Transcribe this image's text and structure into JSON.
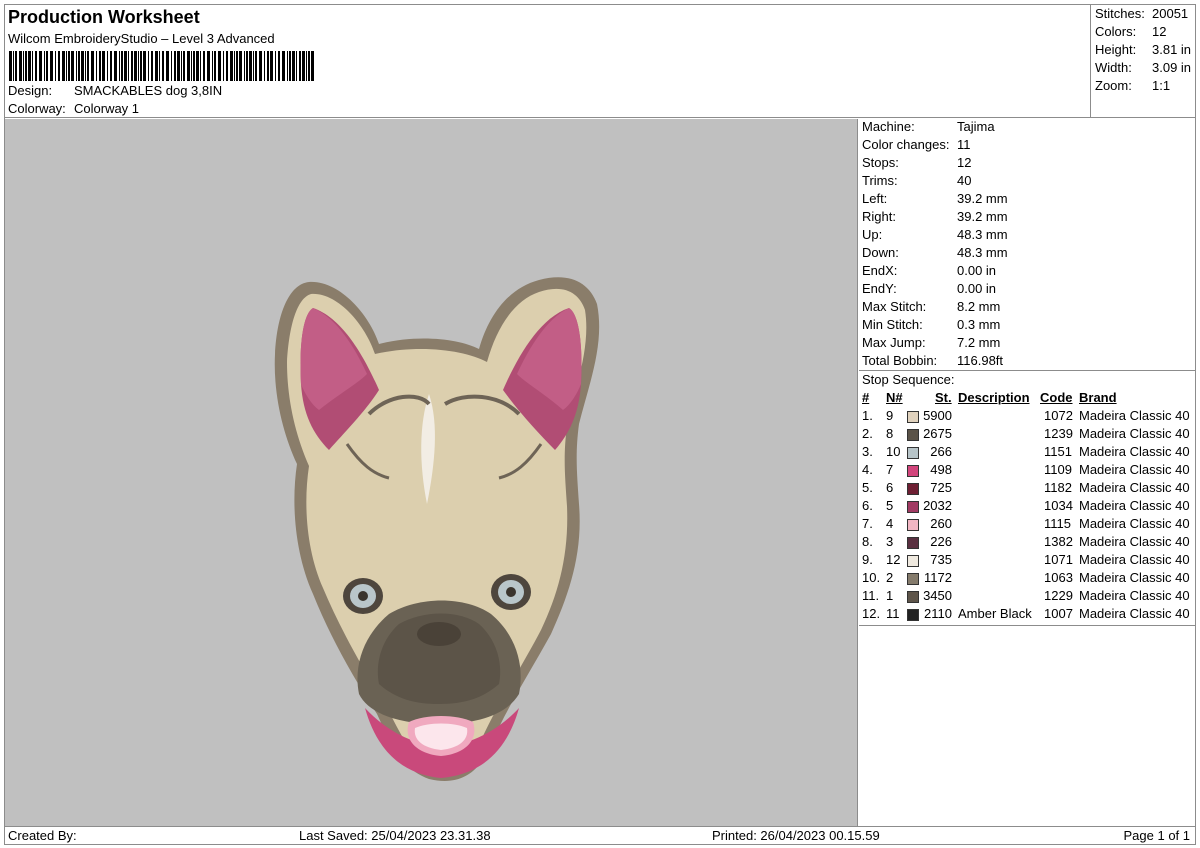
{
  "header": {
    "title": "Production Worksheet",
    "subtitle": "Wilcom EmbroideryStudio – Level 3 Advanced",
    "design_label": "Design:",
    "design_value": "SMACKABLES dog 3,8IN",
    "colorway_label": "Colorway:",
    "colorway_value": "Colorway 1"
  },
  "summary": [
    {
      "label": "Stitches:",
      "value": "20051"
    },
    {
      "label": "Colors:",
      "value": "12"
    },
    {
      "label": "Height:",
      "value": "3.81 in"
    },
    {
      "label": "Width:",
      "value": "3.09 in"
    },
    {
      "label": "Zoom:",
      "value": "1:1"
    }
  ],
  "machine": [
    {
      "label": "Machine:",
      "value": "Tajima"
    },
    {
      "label": "Color changes:",
      "value": "11"
    },
    {
      "label": "Stops:",
      "value": "12"
    },
    {
      "label": "Trims:",
      "value": "40"
    },
    {
      "label": "Left:",
      "value": "39.2 mm"
    },
    {
      "label": "Right:",
      "value": "39.2 mm"
    },
    {
      "label": "Up:",
      "value": "48.3 mm"
    },
    {
      "label": "Down:",
      "value": "48.3 mm"
    },
    {
      "label": "EndX:",
      "value": "0.00 in"
    },
    {
      "label": "EndY:",
      "value": "0.00 in"
    },
    {
      "label": "Max Stitch:",
      "value": "8.2 mm"
    },
    {
      "label": "Min Stitch:",
      "value": "0.3 mm"
    },
    {
      "label": "Max Jump:",
      "value": "7.2 mm"
    },
    {
      "label": "Total Bobbin:",
      "value": "116.98ft"
    }
  ],
  "stop_sequence": {
    "title": "Stop Sequence:",
    "headers": {
      "num": "#",
      "n": "N#",
      "st": "St.",
      "desc": "Description",
      "code": "Code",
      "brand": "Brand"
    },
    "rows": [
      {
        "num": "1.",
        "n": "9",
        "color": "#e0d2bd",
        "st": "5900",
        "desc": "",
        "code": "1072",
        "brand": "Madeira Classic 40"
      },
      {
        "num": "2.",
        "n": "8",
        "color": "#5b5348",
        "st": "2675",
        "desc": "",
        "code": "1239",
        "brand": "Madeira Classic 40"
      },
      {
        "num": "3.",
        "n": "10",
        "color": "#b7c4c8",
        "st": "266",
        "desc": "",
        "code": "1151",
        "brand": "Madeira Classic 40"
      },
      {
        "num": "4.",
        "n": "7",
        "color": "#d2457c",
        "st": "498",
        "desc": "",
        "code": "1109",
        "brand": "Madeira Classic 40"
      },
      {
        "num": "5.",
        "n": "6",
        "color": "#6e1f33",
        "st": "725",
        "desc": "",
        "code": "1182",
        "brand": "Madeira Classic 40"
      },
      {
        "num": "6.",
        "n": "5",
        "color": "#a13a63",
        "st": "2032",
        "desc": "",
        "code": "1034",
        "brand": "Madeira Classic 40"
      },
      {
        "num": "7.",
        "n": "4",
        "color": "#f2b6c3",
        "st": "260",
        "desc": "",
        "code": "1115",
        "brand": "Madeira Classic 40"
      },
      {
        "num": "8.",
        "n": "3",
        "color": "#5a3040",
        "st": "226",
        "desc": "",
        "code": "1382",
        "brand": "Madeira Classic 40"
      },
      {
        "num": "9.",
        "n": "12",
        "color": "#efe9df",
        "st": "735",
        "desc": "",
        "code": "1071",
        "brand": "Madeira Classic 40"
      },
      {
        "num": "10.",
        "n": "2",
        "color": "#857b6c",
        "st": "1172",
        "desc": "",
        "code": "1063",
        "brand": "Madeira Classic 40"
      },
      {
        "num": "11.",
        "n": "1",
        "color": "#5e554a",
        "st": "3450",
        "desc": "",
        "code": "1229",
        "brand": "Madeira Classic 40"
      },
      {
        "num": "12.",
        "n": "11",
        "color": "#222222",
        "st": "2110",
        "desc": "Amber Black",
        "code": "1007",
        "brand": "Madeira Classic 40"
      }
    ]
  },
  "footer": {
    "created_by": "Created By:",
    "last_saved": "Last Saved: 25/04/2023 23.31.38",
    "printed": "Printed: 26/04/2023 00.15.59",
    "page": "Page 1 of 1"
  },
  "colors": {
    "preview_bg": "#c0c0c0",
    "border": "#8c8c8c"
  }
}
